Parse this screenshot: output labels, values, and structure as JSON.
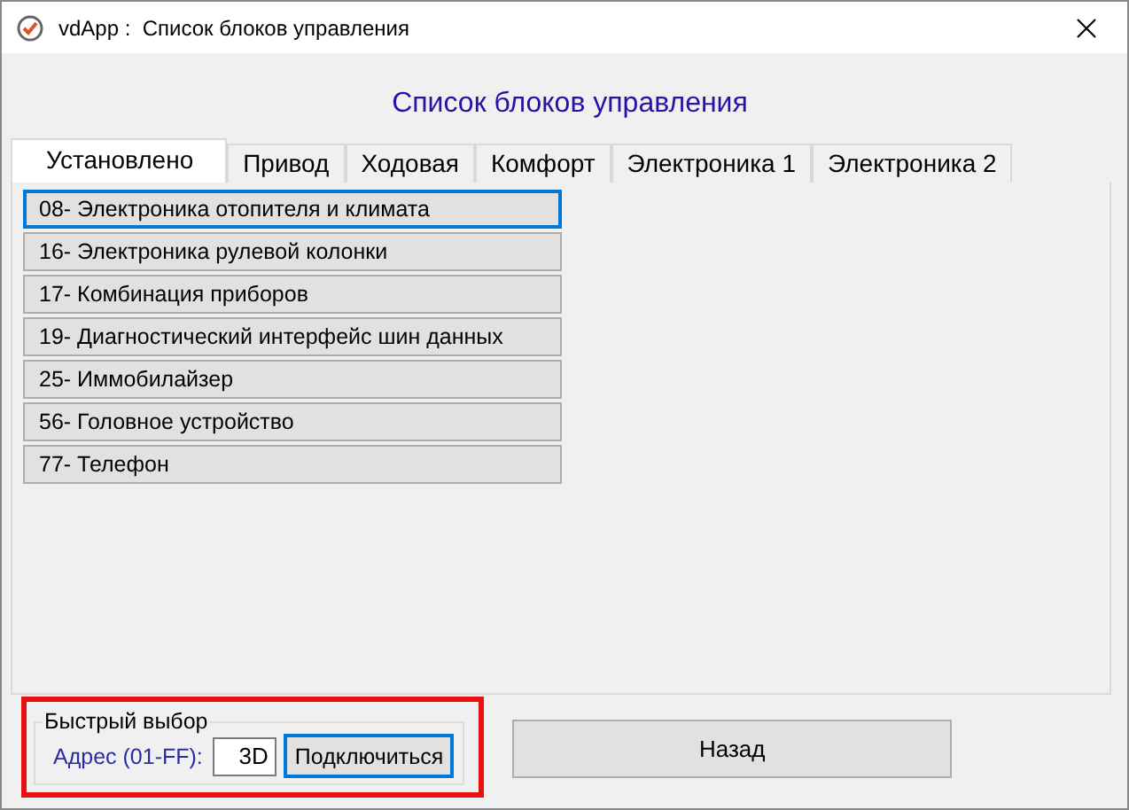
{
  "window": {
    "title": "vdApp :  Список блоков управления"
  },
  "heading": "Список блоков управления",
  "tabs": [
    {
      "label": "Установлено",
      "selected": true
    },
    {
      "label": "Привод",
      "selected": false
    },
    {
      "label": "Ходовая",
      "selected": false
    },
    {
      "label": "Комфорт",
      "selected": false
    },
    {
      "label": "Электроника 1",
      "selected": false
    },
    {
      "label": "Электроника 2",
      "selected": false
    }
  ],
  "modules": [
    {
      "label": "08- Электроника отопителя и климата",
      "focused": true
    },
    {
      "label": "16- Электроника рулевой колонки",
      "focused": false
    },
    {
      "label": "17- Комбинация приборов",
      "focused": false
    },
    {
      "label": "19- Диагностический интерфейс шин данных",
      "focused": false
    },
    {
      "label": "25- Иммобилайзер",
      "focused": false
    },
    {
      "label": "56- Головное устройство",
      "focused": false
    },
    {
      "label": "77- Телефон",
      "focused": false
    }
  ],
  "quick_select": {
    "title": "Быстрый выбор",
    "address_label": "Адрес (01-FF):",
    "address_value": "3D",
    "connect_button": "Подключиться"
  },
  "back_button": "Назад"
}
